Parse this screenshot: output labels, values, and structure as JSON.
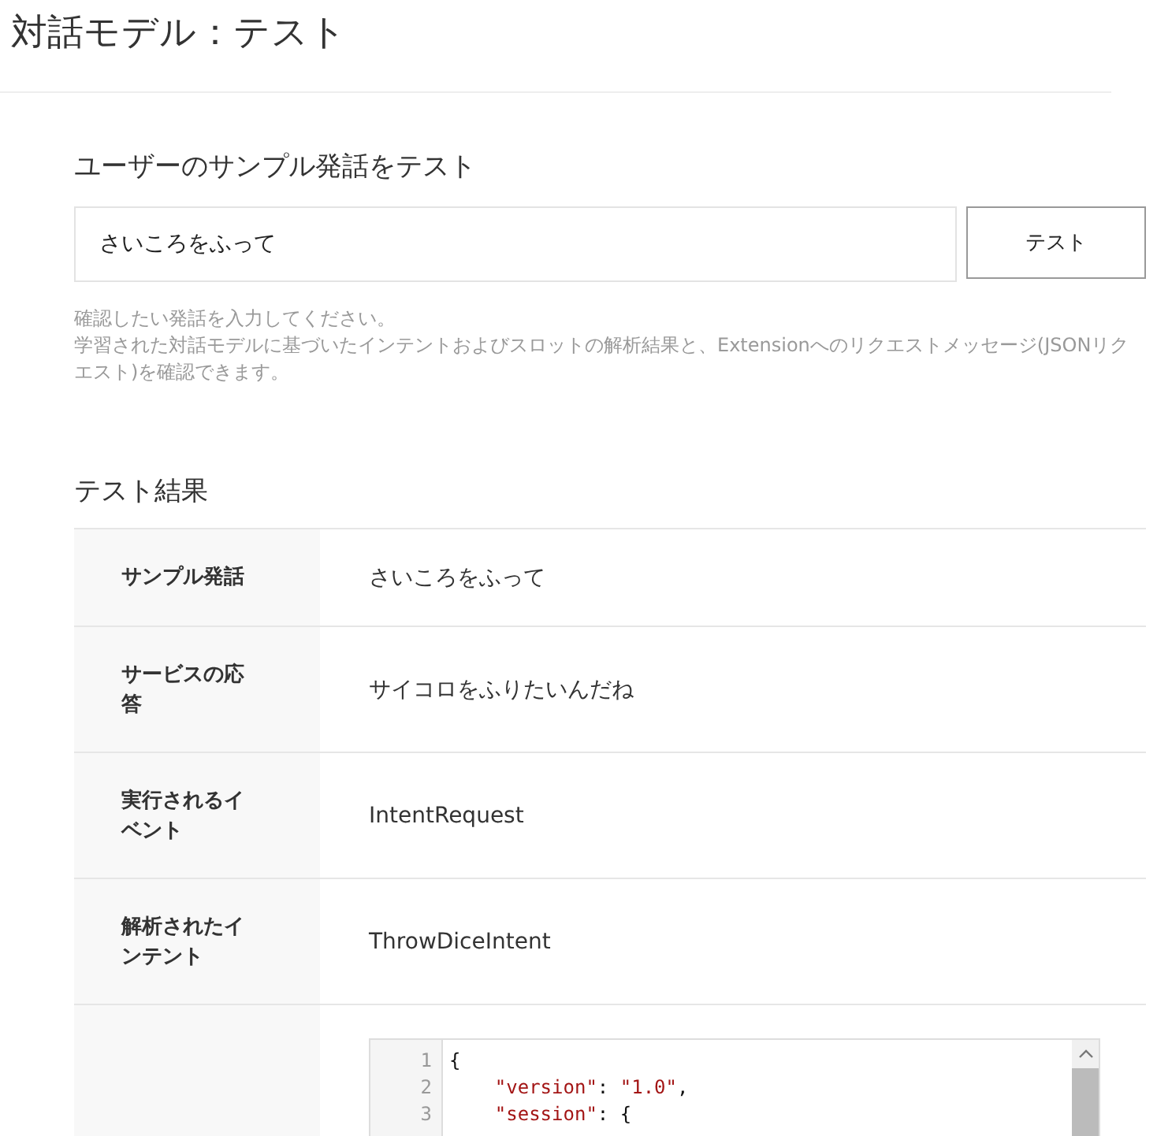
{
  "page_title": "対話モデル：テスト",
  "test_form": {
    "heading": "ユーザーのサンプル発話をテスト",
    "input_value": "さいころをふって",
    "button": "テスト",
    "help_lines": [
      "確認したい発話を入力してください。",
      "学習された対話モデルに基づいたインテントおよびスロットの解析結果と、Extensionへのリクエストメッセージ(JSONリクエスト)を確認できます。"
    ]
  },
  "results": {
    "heading": "テスト結果",
    "rows": [
      {
        "label": "サンプル発話",
        "value": "さいころをふって"
      },
      {
        "label": "サービスの応答",
        "value": "サイコロをふりたいんだね"
      },
      {
        "label": "実行されるイベント",
        "value": "IntentRequest"
      },
      {
        "label": "解析されたインテント",
        "value": "ThrowDiceIntent"
      }
    ],
    "json_request": {
      "lines": [
        {
          "number": "1",
          "indented": false,
          "tokens": [
            {
              "kind": "punct",
              "text": "{"
            }
          ]
        },
        {
          "number": "2",
          "indented": true,
          "tokens": [
            {
              "kind": "string",
              "text": "\"version\""
            },
            {
              "kind": "punct",
              "text": ": "
            },
            {
              "kind": "string",
              "text": "\"1.0\""
            },
            {
              "kind": "punct",
              "text": ","
            }
          ]
        },
        {
          "number": "3",
          "indented": true,
          "tokens": [
            {
              "kind": "string",
              "text": "\"session\""
            },
            {
              "kind": "punct",
              "text": ": {"
            }
          ]
        }
      ]
    }
  }
}
